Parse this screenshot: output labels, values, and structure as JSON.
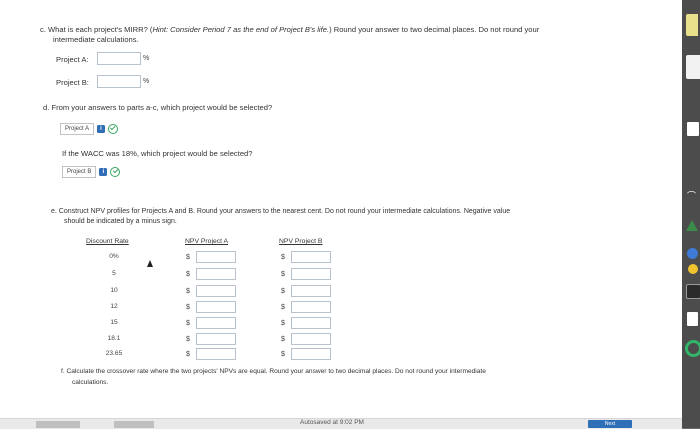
{
  "question_c": {
    "text_prefix": "c. What is each project's MIRR? (",
    "hint": "Hint:",
    "text_italic": " Consider Period 7 as the end of Project B's life.",
    "text_suffix": ") Round your answer to two decimal places. Do not round your",
    "text_line2": "intermediate calculations.",
    "project_a_label": "Project A:",
    "project_b_label": "Project B:",
    "pct": "%"
  },
  "question_d": {
    "text": "d. From your answers to parts a-c, which project would be selected?",
    "answer1": "Project A",
    "wacc_text": "If the WACC was 18%, which project would be selected?",
    "answer2": "Project B"
  },
  "question_e": {
    "line1": "e. Construct NPV profiles for Projects A and B. Round your answers to the nearest cent. Do not round your intermediate calculations. Negative value",
    "line2": "should be indicated by a minus sign.",
    "headers": [
      "Discount Rate",
      "NPV Project A",
      "NPV Project B"
    ],
    "rates": [
      "0%",
      "5",
      "10",
      "12",
      "15",
      "18.1",
      "23.65"
    ],
    "dollar": "$"
  },
  "question_f": {
    "line1": "f. Calculate the crossover rate where the two projects' NPVs are equal. Round your answer to two decimal places. Do not round your intermediate",
    "line2": "calculations."
  },
  "footer": {
    "autosaved": "Autosaved at 9:02 PM",
    "next": "Next"
  },
  "colors": {
    "check": "#37a561",
    "info": "#2f6db6",
    "input_border": "#b8c2cc"
  }
}
